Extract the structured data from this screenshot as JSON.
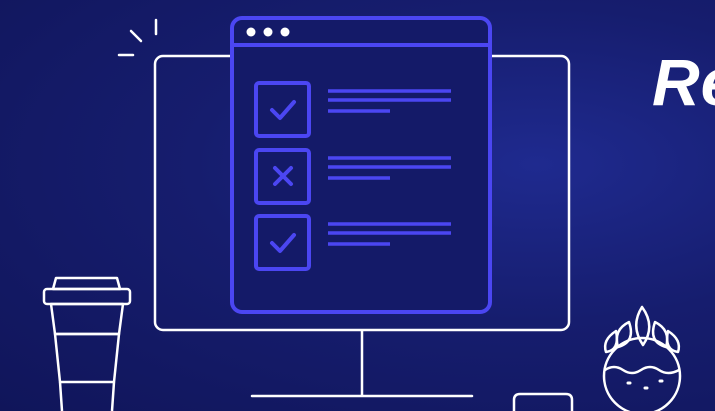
{
  "headline": {
    "text": "Re"
  },
  "checklist": {
    "items": [
      {
        "state": "checked",
        "icon": "check-icon"
      },
      {
        "state": "failed",
        "icon": "x-icon"
      },
      {
        "state": "checked",
        "icon": "check-icon"
      }
    ]
  },
  "colors": {
    "background": "#161d6e",
    "accent": "#4b46f2",
    "line": "#ffffff"
  }
}
